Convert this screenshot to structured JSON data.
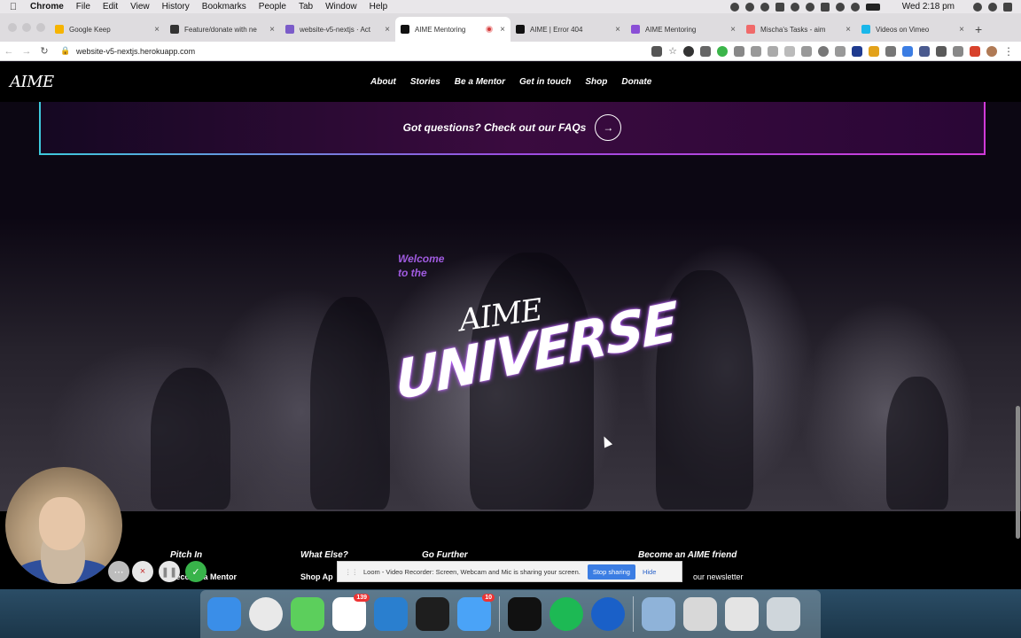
{
  "menubar": {
    "app": "Chrome",
    "items": [
      "File",
      "Edit",
      "View",
      "History",
      "Bookmarks",
      "People",
      "Tab",
      "Window",
      "Help"
    ],
    "clock": "Wed 2:18 pm"
  },
  "tabs": [
    {
      "title": "Google Keep",
      "color": "#f6b400"
    },
    {
      "title": "Feature/donate with ne",
      "color": "#333333"
    },
    {
      "title": "website-v5-nextjs · Act",
      "color": "#7b5cc9"
    },
    {
      "title": "AIME Mentoring",
      "color": "#111111",
      "active": true
    },
    {
      "title": "AIME | Error 404",
      "color": "#111111"
    },
    {
      "title": "AIME Mentoring",
      "color": "#8a4fd6"
    },
    {
      "title": "Mischa's Tasks - aim",
      "color": "#f06a6a"
    },
    {
      "title": "Videos on Vimeo",
      "color": "#1ab7ea"
    }
  ],
  "address": {
    "url": "website-v5-nextjs.herokuapp.com"
  },
  "site": {
    "logo": "AIME",
    "nav": [
      "About",
      "Stories",
      "Be a Mentor",
      "Get in touch",
      "Shop",
      "Donate"
    ],
    "faq_text": "Got questions? Check out our FAQs",
    "hero": {
      "welcome_line1": "Welcome",
      "welcome_line2": "to the",
      "aime": "AIME",
      "universe": "UNIVERSE"
    },
    "footer": [
      {
        "heading": "Pitch In",
        "link": "Become a Mentor"
      },
      {
        "heading": "What Else?",
        "link": "Shop Ap"
      },
      {
        "heading": "Go Further",
        "link": ""
      },
      {
        "heading": "Become an AIME friend",
        "link": "our newsletter"
      }
    ]
  },
  "loom": {
    "message": "Loom - Video Recorder: Screen, Webcam and Mic is sharing your screen.",
    "stop": "Stop sharing",
    "hide": "Hide"
  },
  "dock": {
    "apps": [
      {
        "name": "finder-icon",
        "color": "#3a8ee8"
      },
      {
        "name": "chrome-icon",
        "color": "#e9e9e9"
      },
      {
        "name": "facetime-icon",
        "color": "#5ccf5c"
      },
      {
        "name": "slack-icon",
        "color": "#ffffff",
        "badge": "139"
      },
      {
        "name": "vscode-icon",
        "color": "#2a7fcf"
      },
      {
        "name": "figma-icon",
        "color": "#1e1e1e"
      },
      {
        "name": "messages-icon",
        "color": "#4aa3f7",
        "badge": "10"
      },
      {
        "name": "terminal-icon",
        "color": "#111111"
      },
      {
        "name": "spotify-icon",
        "color": "#1db954"
      },
      {
        "name": "1password-icon",
        "color": "#1a60c8"
      },
      {
        "name": "preview-icon",
        "color": "#8fb3d9"
      },
      {
        "name": "document-icon",
        "color": "#d8d8d8"
      },
      {
        "name": "screenshot-icon",
        "color": "#e4e4e4"
      },
      {
        "name": "trash-icon",
        "color": "#cfd6db"
      }
    ]
  }
}
